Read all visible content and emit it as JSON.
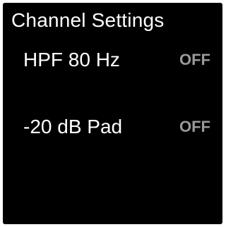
{
  "screen": {
    "title": "Channel Settings"
  },
  "settings": [
    {
      "label": "HPF 80 Hz",
      "value": "OFF"
    },
    {
      "label": "-20 dB Pad",
      "value": "OFF"
    }
  ],
  "colors": {
    "background": "#000000",
    "text": "#ffffff",
    "value_off": "#9a9a9a"
  }
}
